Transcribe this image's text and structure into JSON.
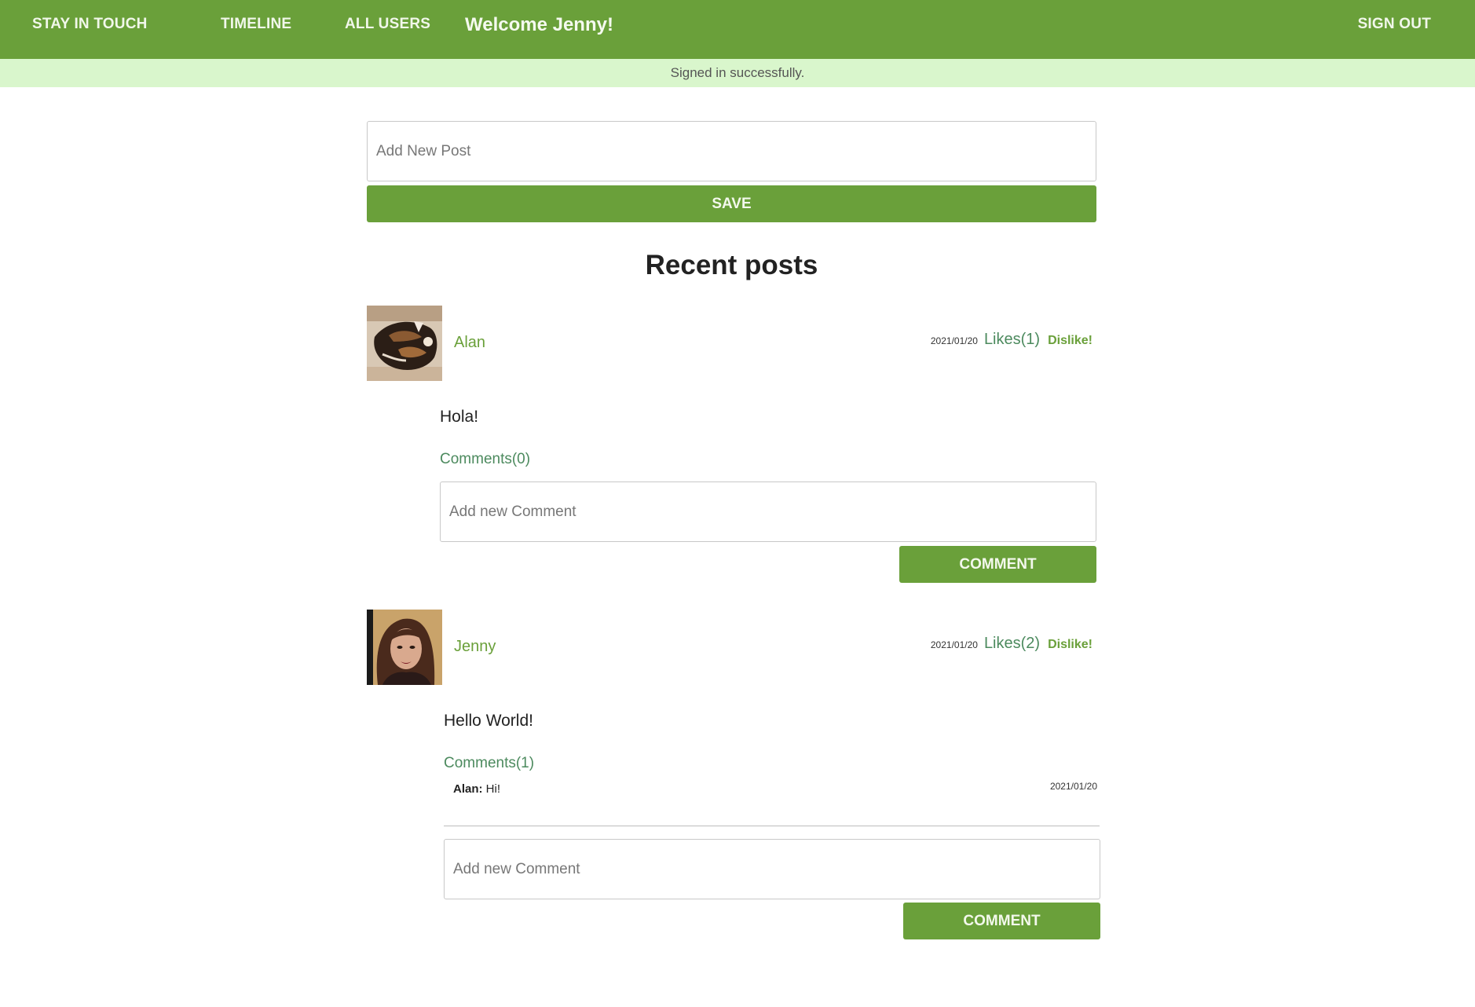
{
  "nav": {
    "brand": "STAY IN TOUCH",
    "timeline": "TIMELINE",
    "all_users": "ALL USERS",
    "welcome": "Welcome Jenny!",
    "sign_out": "SIGN OUT"
  },
  "flash": "Signed in successfully.",
  "new_post": {
    "placeholder": "Add New Post",
    "save_label": "SAVE"
  },
  "section_title": "Recent posts",
  "posts": [
    {
      "author": "Alan",
      "date": "2021/01/20",
      "likes": "Likes(1)",
      "dislike": "Dislike!",
      "body": "Hola!",
      "comments_label": "Comments(0)",
      "comment_placeholder": "Add new Comment",
      "comment_button": "COMMENT"
    },
    {
      "author": "Jenny",
      "date": "2021/01/20",
      "likes": "Likes(2)",
      "dislike": "Dislike!",
      "body": "Hello World!",
      "comments_label": "Comments(1)",
      "comments": [
        {
          "author": "Alan:",
          "text": "Hi!",
          "date": "2021/01/20"
        }
      ],
      "comment_placeholder": "Add new Comment",
      "comment_button": "COMMENT"
    }
  ],
  "colors": {
    "primary": "#6aa03a",
    "flash_bg": "#d9f6cc",
    "link_teal": "#4c8a5e"
  }
}
